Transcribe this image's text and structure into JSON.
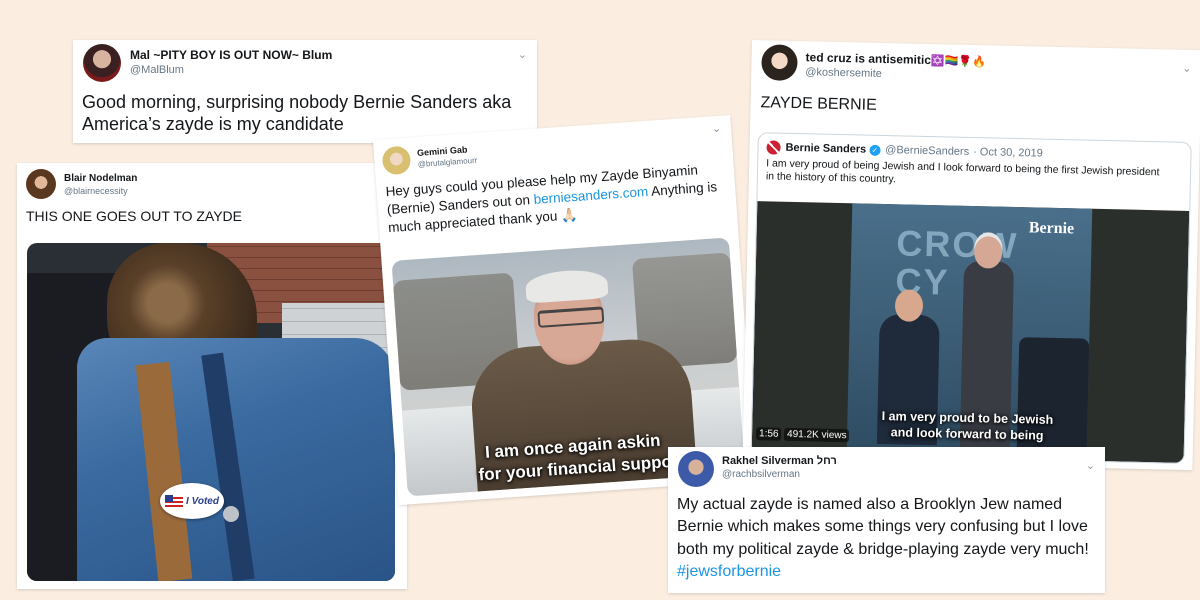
{
  "tweets": [
    {
      "name": "Mal ~PITY BOY IS OUT NOW~ Blum",
      "handle": "@MalBlum",
      "text": "Good morning, surprising nobody Bernie Sanders aka America’s zayde is my candidate"
    },
    {
      "name": "Blair Nodelman",
      "handle": "@blairnecessity",
      "text": "THIS ONE GOES OUT TO ZAYDE",
      "sticker_text": "I Voted"
    },
    {
      "name": "Gemini Gab",
      "handle": "@brutalglamourr",
      "text_before": "Hey guys could you please help my Zayde Binyamin (Bernie) Sanders out on ",
      "link": "berniesanders.com",
      "text_after": " Anything is much appreciated thank you 🙏🏻",
      "caption_1": "I am once again askin",
      "caption_2": "for your financial suppo"
    },
    {
      "name": "ted cruz is antisemitic",
      "name_emojis": "✡️🏳️‍🌈🌹🔥",
      "handle": "@koshersemite",
      "text": "ZAYDE BERNIE",
      "quoted": {
        "name": "Bernie Sanders",
        "handle": "@BernieSanders",
        "date": "· Oct 30, 2019",
        "text": "I am very proud of being Jewish and I look forward to being the first Jewish president in the history of this country.",
        "video_time": "1:56",
        "video_views": "491.2K views",
        "caption_1": "I am very proud to be Jewish",
        "caption_2": "and look forward to being",
        "logo": "Bernie",
        "banner": "CROW CY"
      }
    },
    {
      "name": "Rakhel Silverman רחל",
      "handle": "@rachbsilverman",
      "text_before": "My actual zayde is named also a Brooklyn Jew named Bernie which makes some things very confusing but I love both my political zayde & bridge-playing zayde very much! ",
      "hashtag": "#jewsforbernie"
    }
  ],
  "icons": {
    "chevron": "chevron-down-icon",
    "verified": "verified-badge-icon",
    "flag": "uk-flag-icon"
  },
  "colors": {
    "background": "#fbeee1",
    "link": "#1b95e0",
    "verified": "#1da1f2"
  }
}
